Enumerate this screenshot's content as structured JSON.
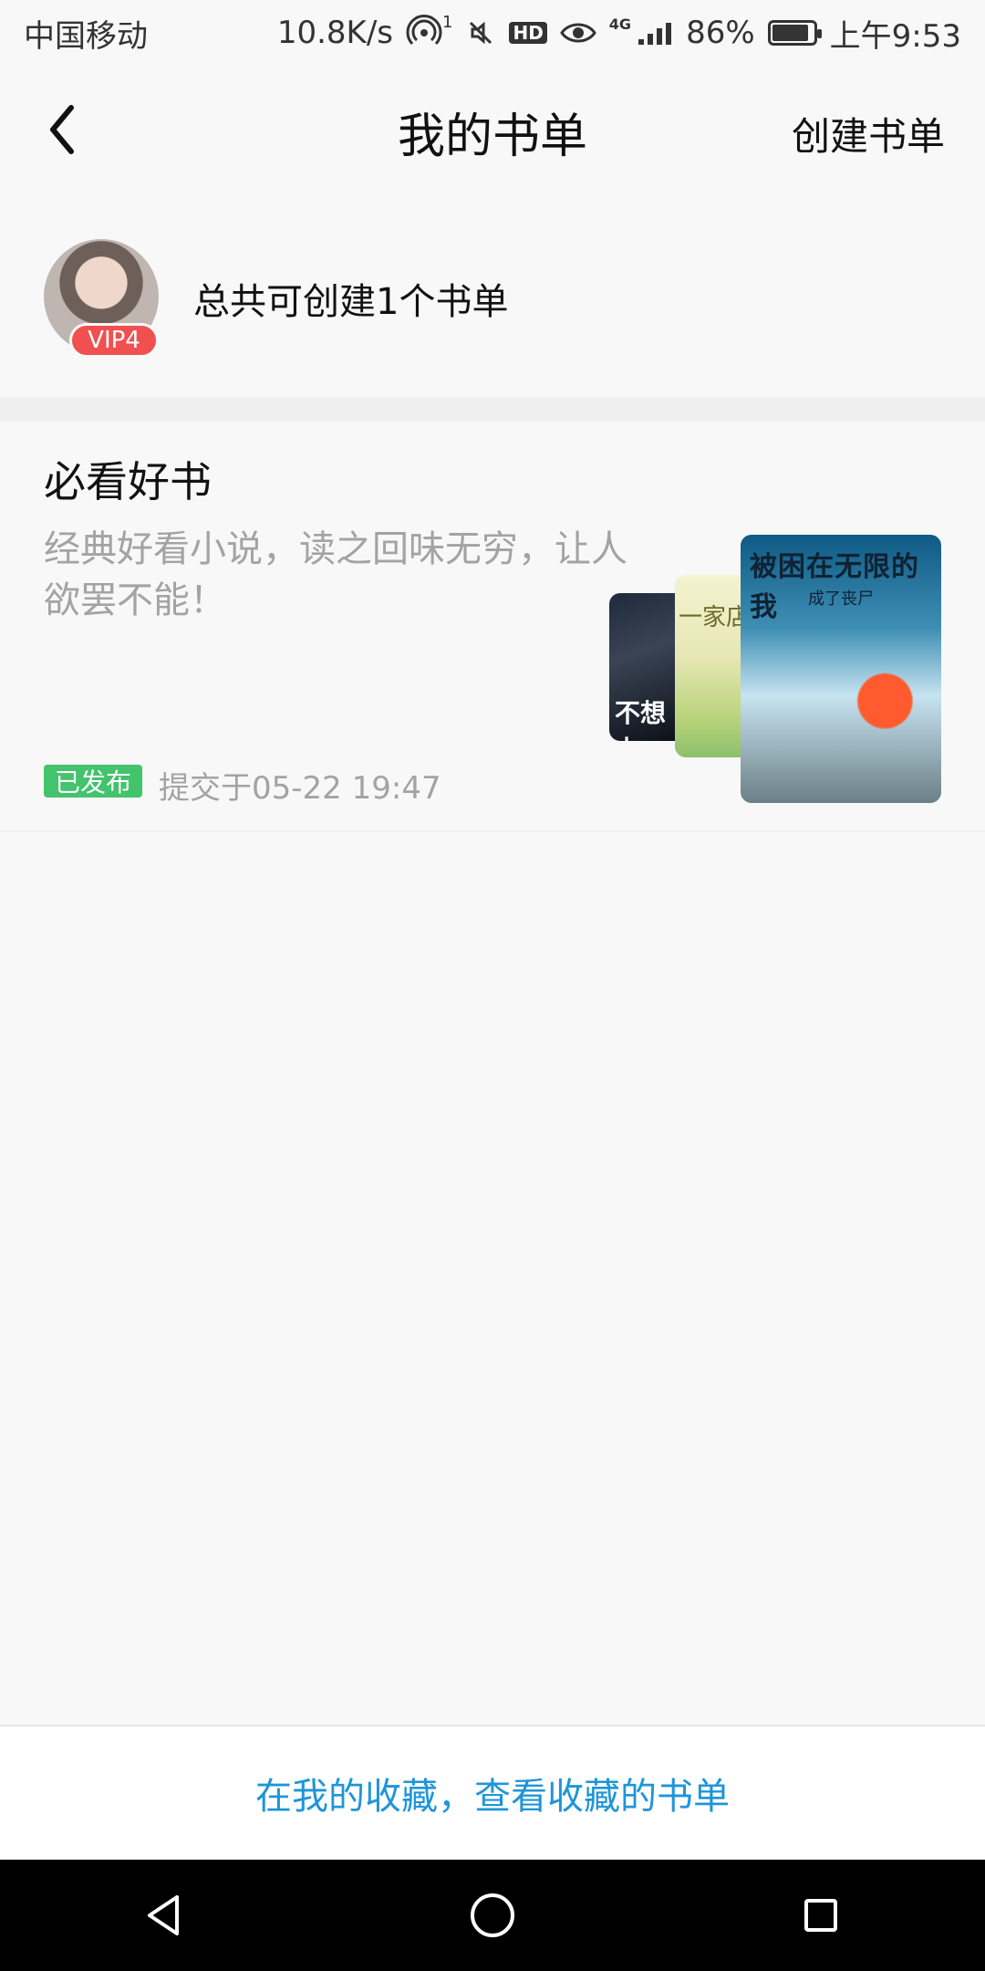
{
  "status_bar": {
    "carrier": "中国移动",
    "network_speed": "10.8K/s",
    "hotspot_sup": "1",
    "hd": "HD",
    "net_type": "4G",
    "battery_percent": "86%",
    "battery_level": 0.86,
    "time": "上午9:53"
  },
  "header": {
    "title": "我的书单",
    "create_label": "创建书单",
    "back_icon": "chevron-left-icon"
  },
  "user": {
    "vip_label": "VIP4",
    "quota_text": "总共可创建1个书单"
  },
  "booklist": {
    "title": "必看好书",
    "description": "经典好看小说，读之回味无穷，让人欲罢不能！",
    "status_label": "已发布",
    "submitted_text": "提交于05-22 19:47",
    "covers": {
      "cover1_title": "不想上",
      "cover2_title": "一家店",
      "cover3_title": "被困在无限的我",
      "cover3_subtitle": "成了丧尸"
    }
  },
  "bottom_link": {
    "label": "在我的收藏，查看收藏的书单"
  },
  "nav": {
    "back": "back-triangle-icon",
    "home": "home-circle-icon",
    "recents": "recents-square-icon"
  },
  "colors": {
    "accent_link": "#1f95d8",
    "published_green": "#42c36c",
    "vip_red": "#f05050"
  }
}
